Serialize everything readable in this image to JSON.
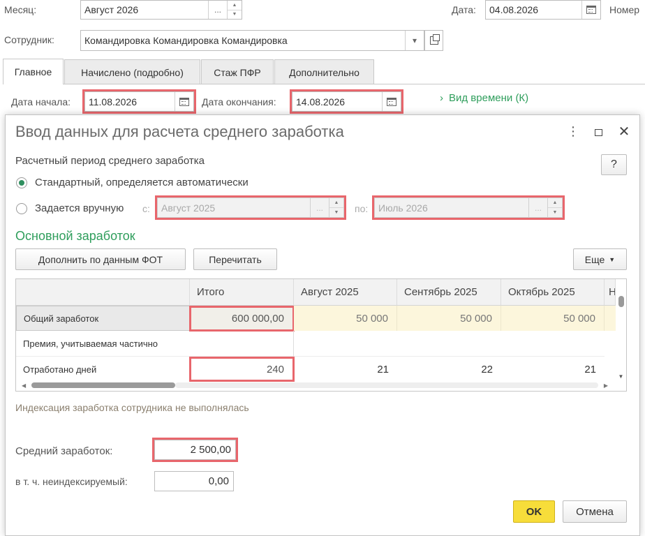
{
  "header": {
    "month_label": "Месяц:",
    "month_value": "Август 2026",
    "date_label": "Дата:",
    "date_value": "04.08.2026",
    "number_label": "Номер",
    "employee_label": "Сотрудник:",
    "employee_value": "Командировка Командировка Командировка"
  },
  "tabs": [
    {
      "label": "Главное"
    },
    {
      "label": "Начислено (подробно)"
    },
    {
      "label": "Стаж ПФР"
    },
    {
      "label": "Дополнительно"
    }
  ],
  "main": {
    "start_label": "Дата начала:",
    "start_value": "11.08.2026",
    "end_label": "Дата окончания:",
    "end_value": "14.08.2026",
    "time_kind_link": "Вид времени (К)"
  },
  "dialog": {
    "title": "Ввод данных для расчета среднего заработка",
    "help_label": "?",
    "period_section": "Расчетный период среднего заработка",
    "radio_standard": "Стандартный, определяется автоматически",
    "radio_manual": "Задается вручную",
    "from_label": "с:",
    "from_value": "Август 2025",
    "to_label": "по:",
    "to_value": "Июль 2026",
    "earnings_section": "Основной заработок",
    "fill_button": "Дополнить по данным ФОТ",
    "reread_button": "Перечитать",
    "more_button": "Еще",
    "grid": {
      "headers": [
        "Итого",
        "Август 2025",
        "Сентябрь 2025",
        "Октябрь 2025",
        "Н"
      ],
      "rows": [
        {
          "name": "Общий заработок",
          "total": "600 000,00",
          "months": [
            "50 000",
            "50 000",
            "50 000"
          ]
        },
        {
          "name": "Премия, учитываемая частично",
          "total": "",
          "months": [
            "",
            "",
            ""
          ]
        },
        {
          "name": "Отработано дней",
          "total": "240",
          "months": [
            "21",
            "22",
            "21"
          ]
        }
      ]
    },
    "indexation_note": "Индексация заработка сотрудника не выполнялась",
    "avg_label": "Средний заработок:",
    "avg_value": "2 500,00",
    "nonindexed_label": "в т. ч. неиндексируемый:",
    "nonindexed_value": "0,00",
    "ok_button": "OK",
    "cancel_button": "Отмена"
  },
  "colors": {
    "accent_green": "#2f9e5c",
    "highlight_red": "#e8666c",
    "ok_yellow": "#f7dd3a",
    "selected_row": "#fcf6dc"
  }
}
